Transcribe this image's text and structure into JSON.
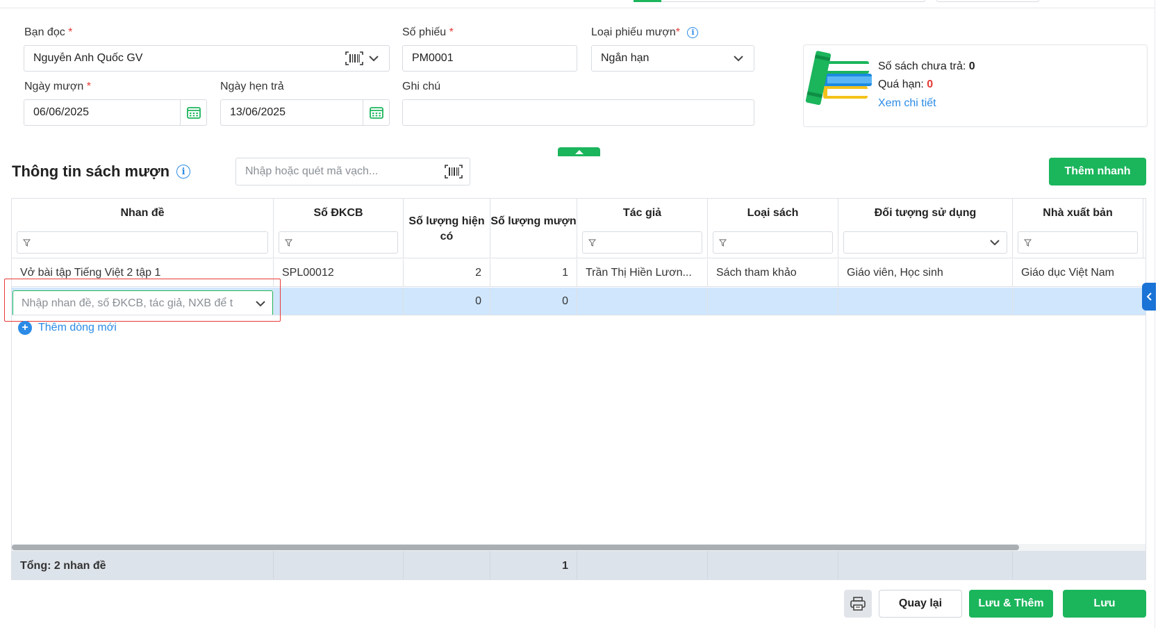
{
  "form": {
    "reader_label": "Bạn đọc",
    "reader_value": "Nguyễn Anh Quốc GV",
    "slip_no_label": "Số phiếu",
    "slip_no_value": "PM0001",
    "slip_type_label": "Loại phiếu mượn",
    "slip_type_value": "Ngắn hạn",
    "borrow_date_label": "Ngày mượn",
    "borrow_date_value": "06/06/2025",
    "due_date_label": "Ngày hẹn trả",
    "due_date_value": "13/06/2025",
    "note_label": "Ghi chú",
    "note_value": "",
    "required_mark": "*"
  },
  "summary": {
    "unreturned_label": "Số sách chưa trả:",
    "unreturned_value": "0",
    "overdue_label": "Quá hạn:",
    "overdue_value": "0",
    "detail_link": "Xem chi tiết"
  },
  "section": {
    "title": "Thông tin sách mượn",
    "barcode_placeholder": "Nhập hoặc quét mã vạch...",
    "quick_add_label": "Thêm nhanh"
  },
  "table": {
    "columns": [
      {
        "label": "Nhan đề"
      },
      {
        "label": "Số ĐKCB"
      },
      {
        "label": "Số lượng hiện có"
      },
      {
        "label": "Số lượng mượn"
      },
      {
        "label": "Tác giả"
      },
      {
        "label": "Loại sách"
      },
      {
        "label": "Đối tượng sử dụng"
      },
      {
        "label": "Nhà xuất bản"
      }
    ],
    "rows": [
      {
        "title": "Vở bài tập Tiếng Việt 2 tập 1",
        "code": "SPL00012",
        "available": "2",
        "borrow": "1",
        "author": "Trần Thị Hiền Lươn...",
        "type": "Sách tham khảo",
        "audience": "Giáo viên, Học sinh",
        "publisher": "Giáo dục Việt Nam"
      }
    ],
    "new_row": {
      "placeholder": "Nhập nhan đề, số ĐKCB, tác giả, NXB để t",
      "available": "0",
      "borrow": "0"
    },
    "add_row_label": "Thêm dòng mới",
    "footer_total": "Tổng: 2 nhan đề",
    "footer_borrow_sum": "1"
  },
  "actions": {
    "back": "Quay lại",
    "save_add": "Lưu & Thêm",
    "save": "Lưu"
  },
  "colors": {
    "primary_green": "#1bb55c",
    "link_blue": "#2b8be6",
    "required_red": "#e53935",
    "active_row": "#cfe6fd"
  }
}
